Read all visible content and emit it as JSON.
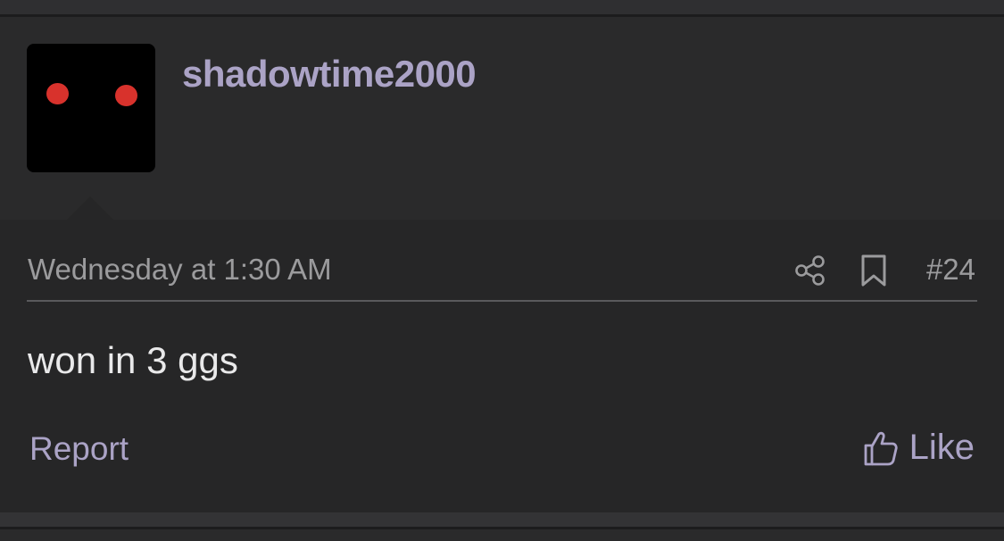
{
  "post": {
    "username": "shadowtime2000",
    "date": "Wednesday at 1:30 AM",
    "post_number": "#24",
    "content": "won in 3 ggs",
    "avatar": {
      "background": "#000000",
      "eye_color": "#d8322c"
    }
  },
  "actions": {
    "report_label": "Report",
    "like_label": "Like",
    "share_icon": "share-icon",
    "bookmark_icon": "bookmark-icon",
    "like_icon": "thumbs-up-icon"
  },
  "colors": {
    "accent": "#aba3c6",
    "background": "#262627",
    "text": "#e9e9ea",
    "muted": "#9b9b9d"
  }
}
